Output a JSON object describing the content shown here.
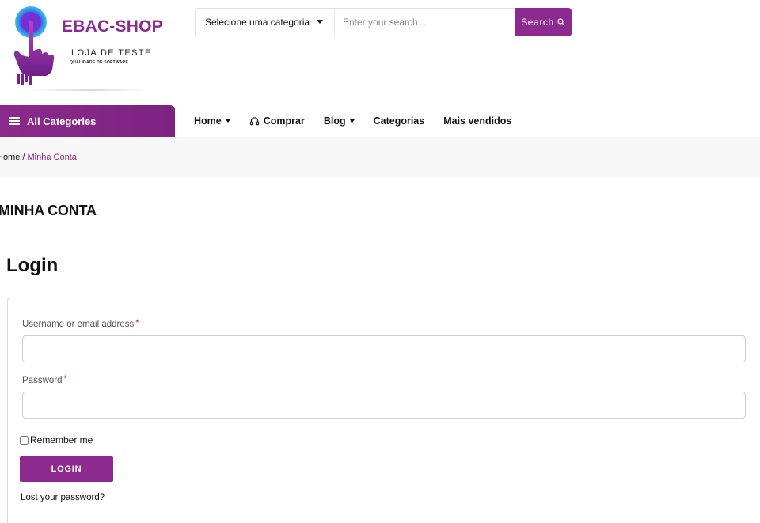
{
  "brand": {
    "name": "EBAC-SHOP",
    "tagline": "LOJA DE TESTE",
    "subtagline": "QUALIDADE DE SOFTWARE",
    "color": "#8d2a8f",
    "logo_icon": "hand-pointer-icon"
  },
  "search": {
    "category_label": "Selecione uma categoria",
    "placeholder": "Enter your search ...",
    "value": "",
    "button_label": "Search",
    "button_icon": "search-icon"
  },
  "nav": {
    "all_categories_label": "All Categories",
    "items": [
      {
        "label": "Home",
        "has_dropdown": true
      },
      {
        "label": "Comprar",
        "icon": "headset-icon"
      },
      {
        "label": "Blog",
        "has_dropdown": true
      },
      {
        "label": "Categorias"
      },
      {
        "label": "Mais vendidos"
      }
    ]
  },
  "breadcrumb": {
    "home": "Home",
    "separator": " / ",
    "current": "Minha Conta"
  },
  "page": {
    "title": "MINHA CONTA",
    "login_heading": "Login"
  },
  "login_form": {
    "username_label": "Username or email address",
    "username_value": "",
    "password_label": "Password",
    "password_value": "",
    "required_mark": "*",
    "remember_label": "Remember me",
    "remember_checked": false,
    "submit_label": "LOGIN",
    "lost_password_label": "Lost your password?"
  }
}
